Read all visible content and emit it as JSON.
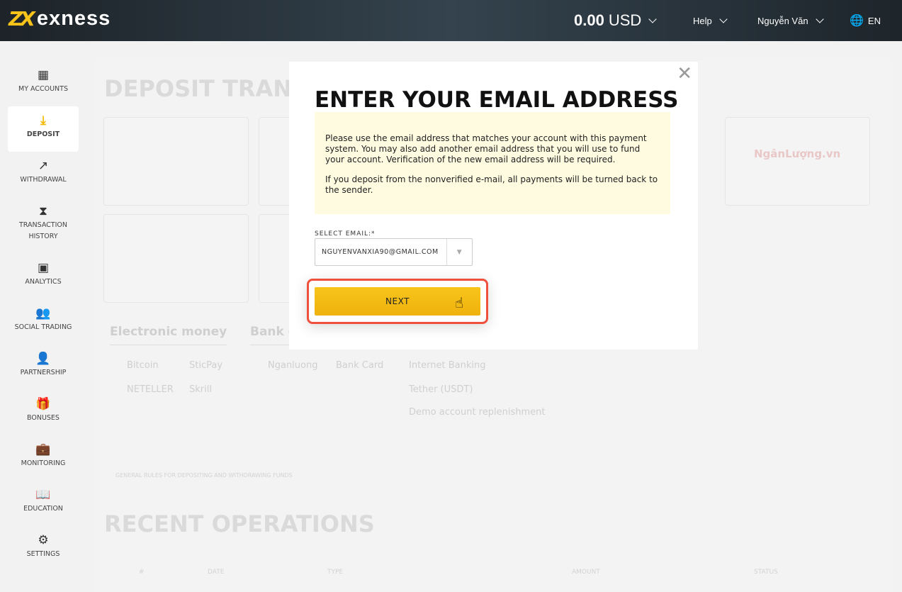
{
  "header": {
    "logo": "exness",
    "balance_amount": "0.00",
    "balance_currency": "USD",
    "help": "Help",
    "user": "Nguyễn Văn",
    "language": "EN"
  },
  "sidebar": {
    "items": [
      {
        "label": "MY ACCOUNTS",
        "icon": "dashboard-icon",
        "glyph": "▦"
      },
      {
        "label": "DEPOSIT",
        "icon": "download-icon",
        "glyph": "⤓",
        "active": true
      },
      {
        "label": "WITHDRAWAL",
        "icon": "upload-arrow-icon",
        "glyph": "↗"
      },
      {
        "label": "TRANSACTION HISTORY",
        "icon": "hourglass-icon",
        "glyph": "⧗"
      },
      {
        "label": "ANALYTICS",
        "icon": "presentation-chart-icon",
        "glyph": "▣"
      },
      {
        "label": "SOCIAL TRADING",
        "icon": "users-icon",
        "glyph": "👥"
      },
      {
        "label": "PARTNERSHIP",
        "icon": "partner-icon",
        "glyph": "👤"
      },
      {
        "label": "BONUSES",
        "icon": "gift-icon",
        "glyph": "🎁"
      },
      {
        "label": "MONITORING",
        "icon": "briefcase-icon",
        "glyph": "💼"
      },
      {
        "label": "EDUCATION",
        "icon": "book-icon",
        "glyph": "📖"
      },
      {
        "label": "SETTINGS",
        "icon": "gear-icon",
        "glyph": "⚙"
      }
    ]
  },
  "background": {
    "title": "DEPOSIT TRANSA",
    "tabs": [
      "Electronic money",
      "Bank c"
    ],
    "methods": [
      "Bitcoin",
      "SticPay",
      "NETELLER",
      "Skrill",
      "Nganluong",
      "Bank Card",
      "Internet Banking",
      "Tether (USDT)",
      "Demo account replenishment"
    ],
    "card_logo": "NgânLượng.vn",
    "rules": "GENERAL RULES FOR DEPOSITING AND WITHDRAWING FUNDS",
    "recent_title": "RECENT OPERATIONS",
    "table_headers": [
      "#",
      "DATE",
      "TYPE",
      "AMOUNT",
      "STATUS"
    ]
  },
  "modal": {
    "title": "ENTER YOUR EMAIL ADDRESS",
    "info_1": "Please use the email address that matches your account with this payment system. You may also add another email address that you will use to fund your account. Verification of the new email address will be required.",
    "info_2": "If you deposit from the nonverified e-mail, all payments will be turned back to the sender.",
    "select_label": "SELECT EMAIL:*",
    "select_value": "NGUYENVANXIA90@GMAIL.COM",
    "next_label": "NEXT"
  },
  "colors": {
    "accent": "#f5b800",
    "highlight": "#f0513c",
    "info_bg": "#fffbe0"
  }
}
